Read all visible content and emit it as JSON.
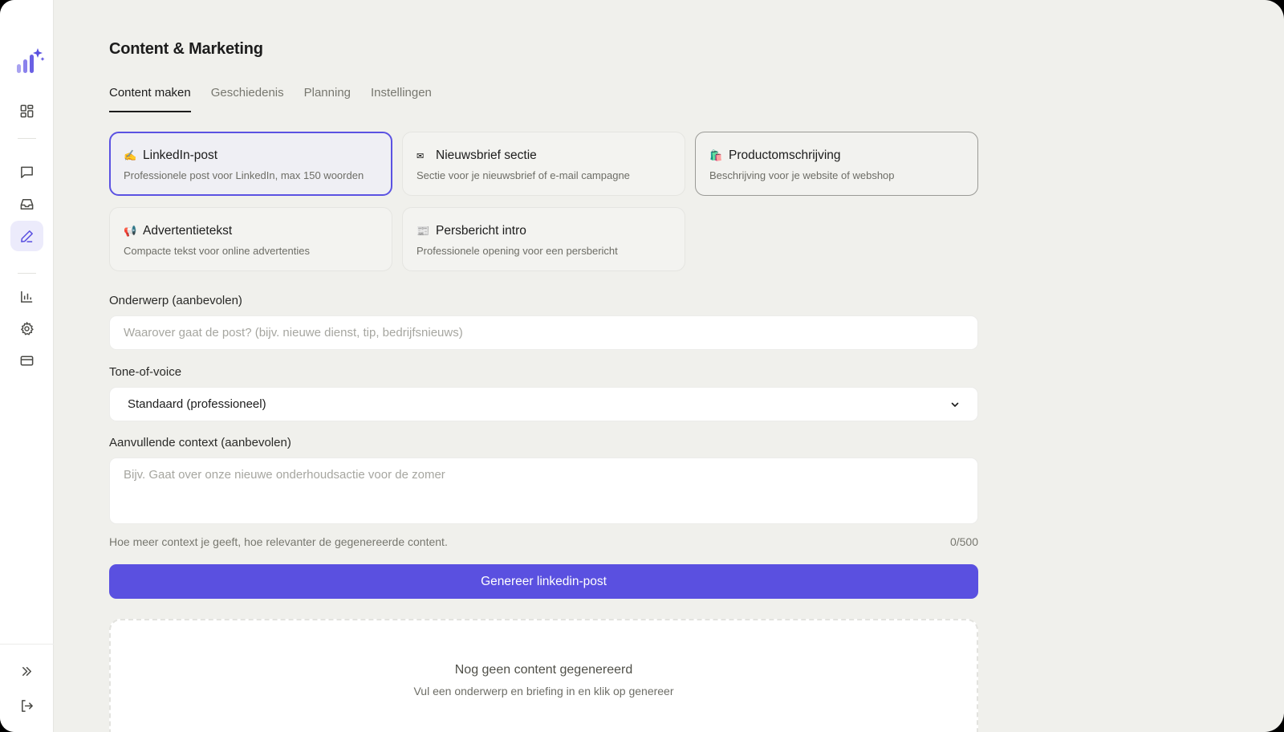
{
  "page": {
    "title": "Content & Marketing"
  },
  "tabs": [
    {
      "label": "Content maken",
      "active": true
    },
    {
      "label": "Geschiedenis"
    },
    {
      "label": "Planning"
    },
    {
      "label": "Instellingen"
    }
  ],
  "content_types": [
    {
      "icon": "✍️",
      "title": "LinkedIn-post",
      "desc": "Professionele post voor LinkedIn, max 150 woorden",
      "selected": true
    },
    {
      "icon": "✉",
      "title": "Nieuwsbrief sectie",
      "desc": "Sectie voor je nieuwsbrief of e-mail campagne"
    },
    {
      "icon": "🛍️",
      "title": "Productomschrijving",
      "desc": "Beschrijving voor je website of webshop"
    },
    {
      "icon": "📢",
      "title": "Advertentietekst",
      "desc": "Compacte tekst voor online advertenties"
    },
    {
      "icon": "📰",
      "title": "Persbericht intro",
      "desc": "Professionele opening voor een persbericht"
    }
  ],
  "form": {
    "subject_label": "Onderwerp (aanbevolen)",
    "subject_placeholder": "Waarover gaat de post? (bijv. nieuwe dienst, tip, bedrijfsnieuws)",
    "subject_value": "",
    "tone_label": "Tone-of-voice",
    "tone_value": "Standaard (professioneel)",
    "context_label": "Aanvullende context (aanbevolen)",
    "context_placeholder": "Bijv. Gaat over onze nieuwe onderhoudsactie voor de zomer",
    "context_value": "",
    "hint": "Hoe meer context je geeft, hoe relevanter de gegenereerde content.",
    "counter": "0/500",
    "generate_label": "Genereer linkedin-post"
  },
  "empty_state": {
    "title": "Nog geen content gegenereerd",
    "subtitle": "Vul een onderwerp en briefing in en klik op genereer"
  },
  "sidebar": {
    "items": [
      {
        "icon": "dashboard-grid-icon"
      },
      {
        "icon": "chat-bubble-icon"
      },
      {
        "icon": "inbox-icon"
      },
      {
        "icon": "pen-icon",
        "active": true
      },
      {
        "icon": "bar-chart-icon"
      },
      {
        "icon": "gear-icon"
      },
      {
        "icon": "credit-card-icon"
      },
      {
        "icon": "expand-chevrons-icon"
      },
      {
        "icon": "logout-icon"
      }
    ]
  },
  "colors": {
    "accent": "#5a50e0",
    "background": "#f0f0ec",
    "sidebar": "#ffffff"
  }
}
